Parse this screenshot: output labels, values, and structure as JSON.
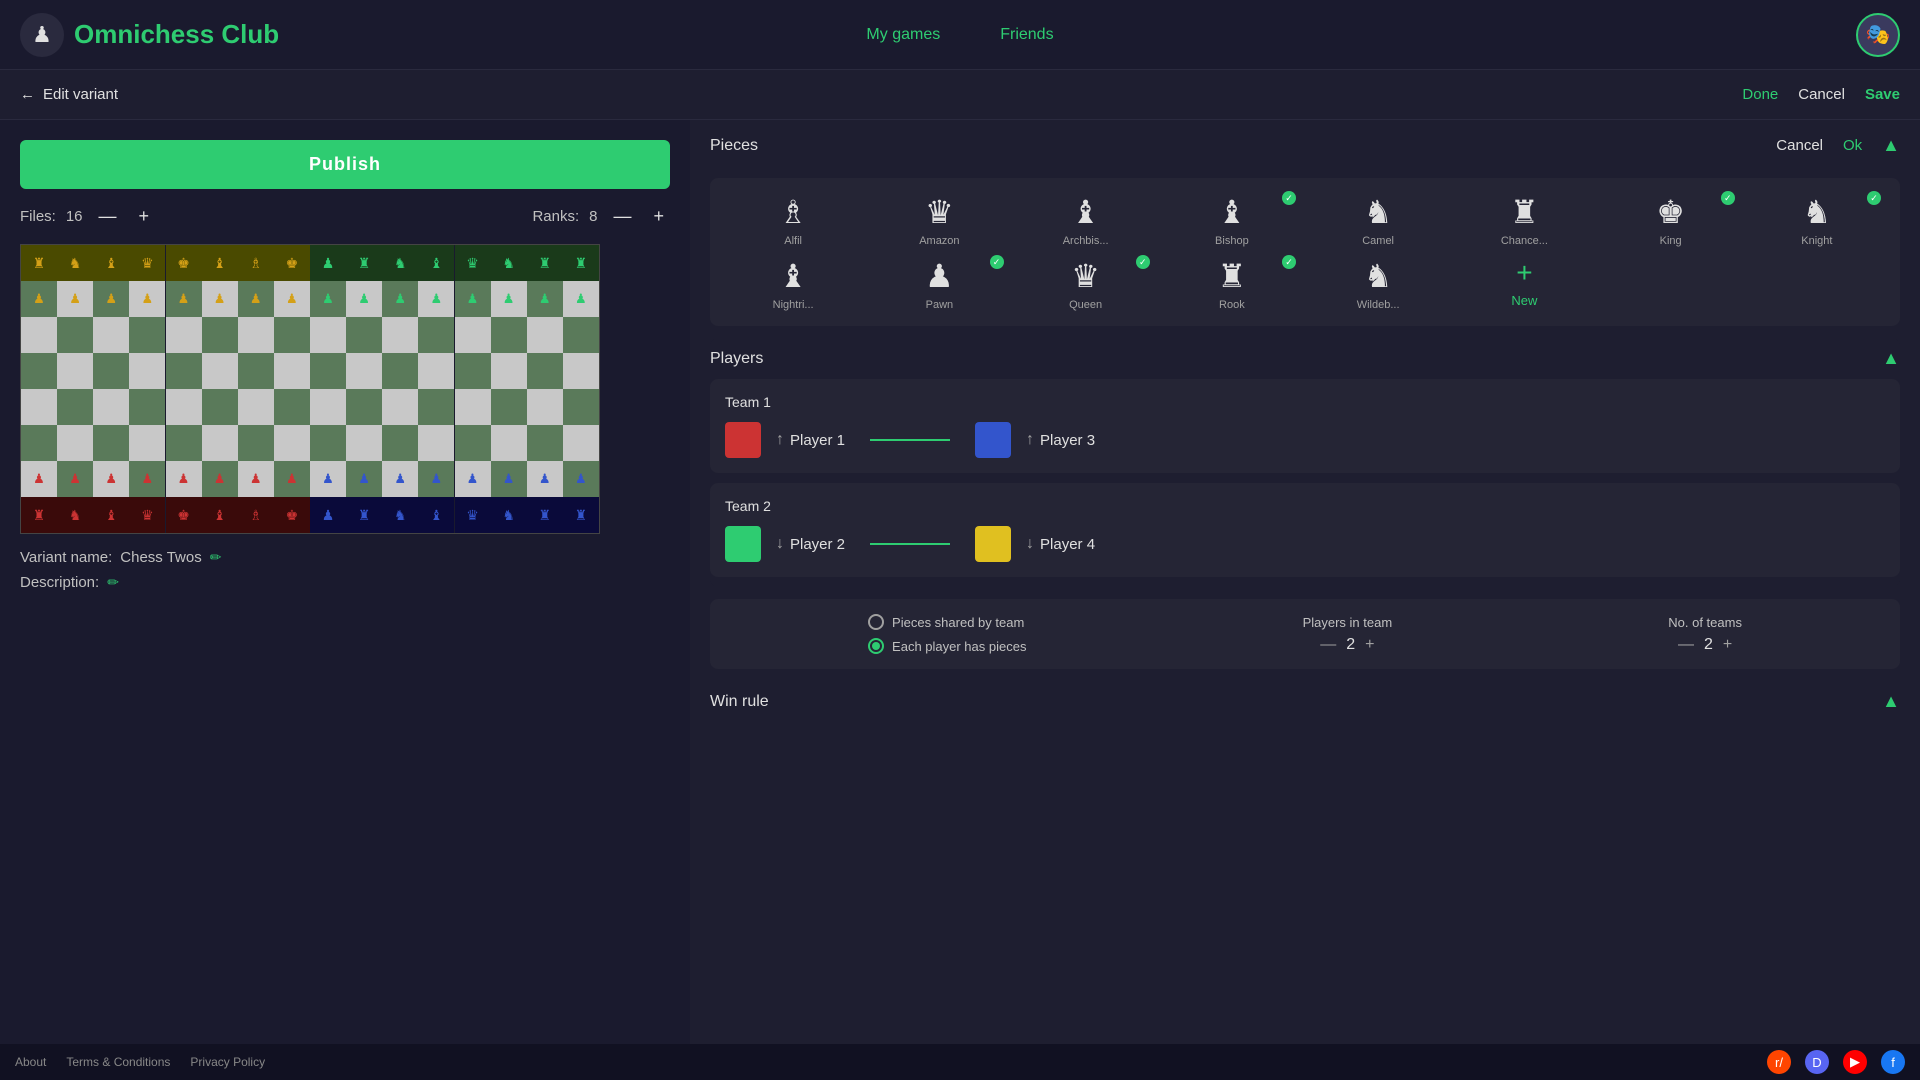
{
  "app": {
    "name": "Omnichess Club",
    "logo_emoji": "♟"
  },
  "header": {
    "nav": [
      {
        "label": "My games",
        "id": "my-games"
      },
      {
        "label": "Friends",
        "id": "friends"
      }
    ],
    "done_label": "Done",
    "cancel_label": "Cancel",
    "save_label": "Save"
  },
  "subheader": {
    "back_label": "Edit variant"
  },
  "left_panel": {
    "publish_label": "Publish",
    "files_label": "Files:",
    "files_value": "16",
    "ranks_label": "Ranks:",
    "ranks_value": "8",
    "variant_name_label": "Variant name:",
    "variant_name": "Chess Twos",
    "description_label": "Description:"
  },
  "pieces_section": {
    "title": "Pieces",
    "cancel_label": "Cancel",
    "ok_label": "Ok",
    "new_label": "New",
    "pieces": [
      {
        "id": "alfil",
        "label": "Alfil",
        "symbol": "♗",
        "checked": false
      },
      {
        "id": "amazon",
        "label": "Amazon",
        "symbol": "♛",
        "checked": false
      },
      {
        "id": "archbishop",
        "label": "Archbis...",
        "symbol": "♝",
        "checked": false
      },
      {
        "id": "bishop",
        "label": "Bishop",
        "symbol": "♝",
        "checked": true
      },
      {
        "id": "camel",
        "label": "Camel",
        "symbol": "♞",
        "checked": false
      },
      {
        "id": "chancellor",
        "label": "Chance...",
        "symbol": "♜",
        "checked": false
      },
      {
        "id": "king",
        "label": "King",
        "symbol": "♚",
        "checked": true
      },
      {
        "id": "knight",
        "label": "Knight",
        "symbol": "♞",
        "checked": true
      },
      {
        "id": "nightrider",
        "label": "Nightri...",
        "symbol": "♝",
        "checked": false
      },
      {
        "id": "pawn",
        "label": "Pawn",
        "symbol": "♟",
        "checked": true
      },
      {
        "id": "queen",
        "label": "Queen",
        "symbol": "♛",
        "checked": true
      },
      {
        "id": "rook",
        "label": "Rook",
        "symbol": "♜",
        "checked": true
      },
      {
        "id": "wildebeest",
        "label": "Wildeb...",
        "symbol": "♞",
        "checked": false
      }
    ]
  },
  "players_section": {
    "title": "Players",
    "team1": {
      "label": "Team 1",
      "players": [
        {
          "id": "player1",
          "name": "Player 1",
          "color": "#cc3333",
          "arrow": "↑"
        },
        {
          "id": "player3",
          "name": "Player 3",
          "color": "#3333cc",
          "arrow": "↑"
        }
      ]
    },
    "team2": {
      "label": "Team 2",
      "players": [
        {
          "id": "player2",
          "name": "Player 2",
          "color": "#2ecc71",
          "arrow": "↓"
        },
        {
          "id": "player4",
          "name": "Player 4",
          "color": "#e0c020",
          "arrow": "↓"
        }
      ]
    }
  },
  "game_settings": {
    "pieces_shared_label": "Pieces shared by team",
    "each_player_label": "Each player has pieces",
    "selected_option": "each_player",
    "players_in_team_label": "Players in team",
    "players_in_team_value": "2",
    "no_of_teams_label": "No. of teams",
    "no_of_teams_value": "2"
  },
  "win_rule": {
    "title": "Win rule"
  },
  "footer": {
    "about": "About",
    "terms": "Terms & Conditions",
    "privacy": "Privacy Policy"
  }
}
